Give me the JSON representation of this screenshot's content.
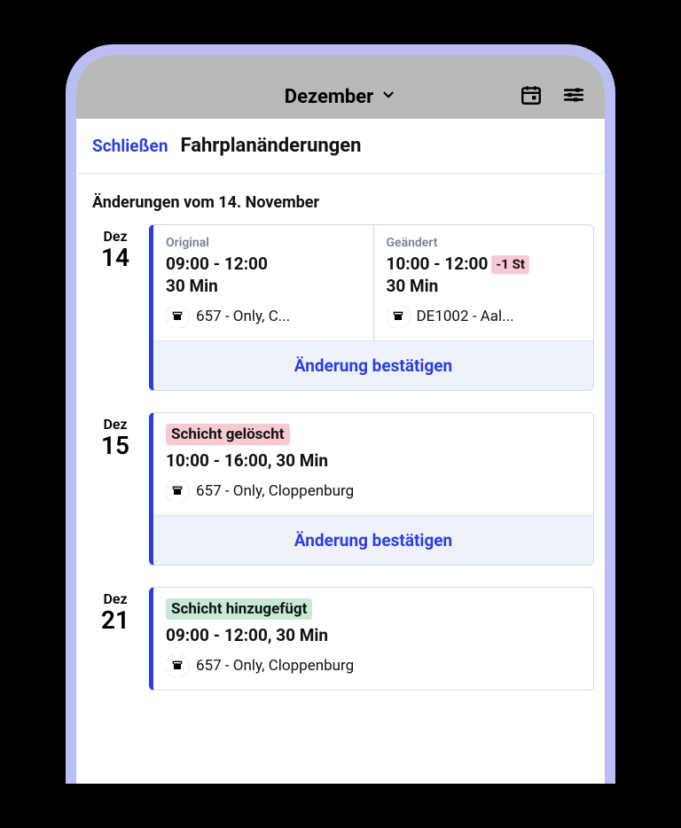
{
  "topbar": {
    "month_label": "Dezember"
  },
  "modal": {
    "close_label": "Schließen",
    "title": "Fahrplanänderungen"
  },
  "section_subtitle": "Änderungen vom 14. November",
  "confirm_label": "Änderung bestätigen",
  "entries": [
    {
      "month": "Dez",
      "day": "14",
      "type": "changed",
      "original": {
        "label": "Original",
        "time": "09:00 - 12:00",
        "break": "30 Min",
        "location": "657 - Only, C..."
      },
      "changed": {
        "label": "Geändert",
        "time": "10:00 - 12:00",
        "delta": "-1 St",
        "break": "30 Min",
        "location": "DE1002 - Aal..."
      }
    },
    {
      "month": "Dez",
      "day": "15",
      "type": "deleted",
      "status_label": "Schicht gelöscht",
      "shift_line": "10:00 - 16:00, 30 Min",
      "location": "657 - Only, Cloppenburg"
    },
    {
      "month": "Dez",
      "day": "21",
      "type": "added",
      "status_label": "Schicht hinzugefügt",
      "shift_line": "09:00 - 12:00, 30 Min",
      "location": "657 - Only, Cloppenburg"
    }
  ]
}
